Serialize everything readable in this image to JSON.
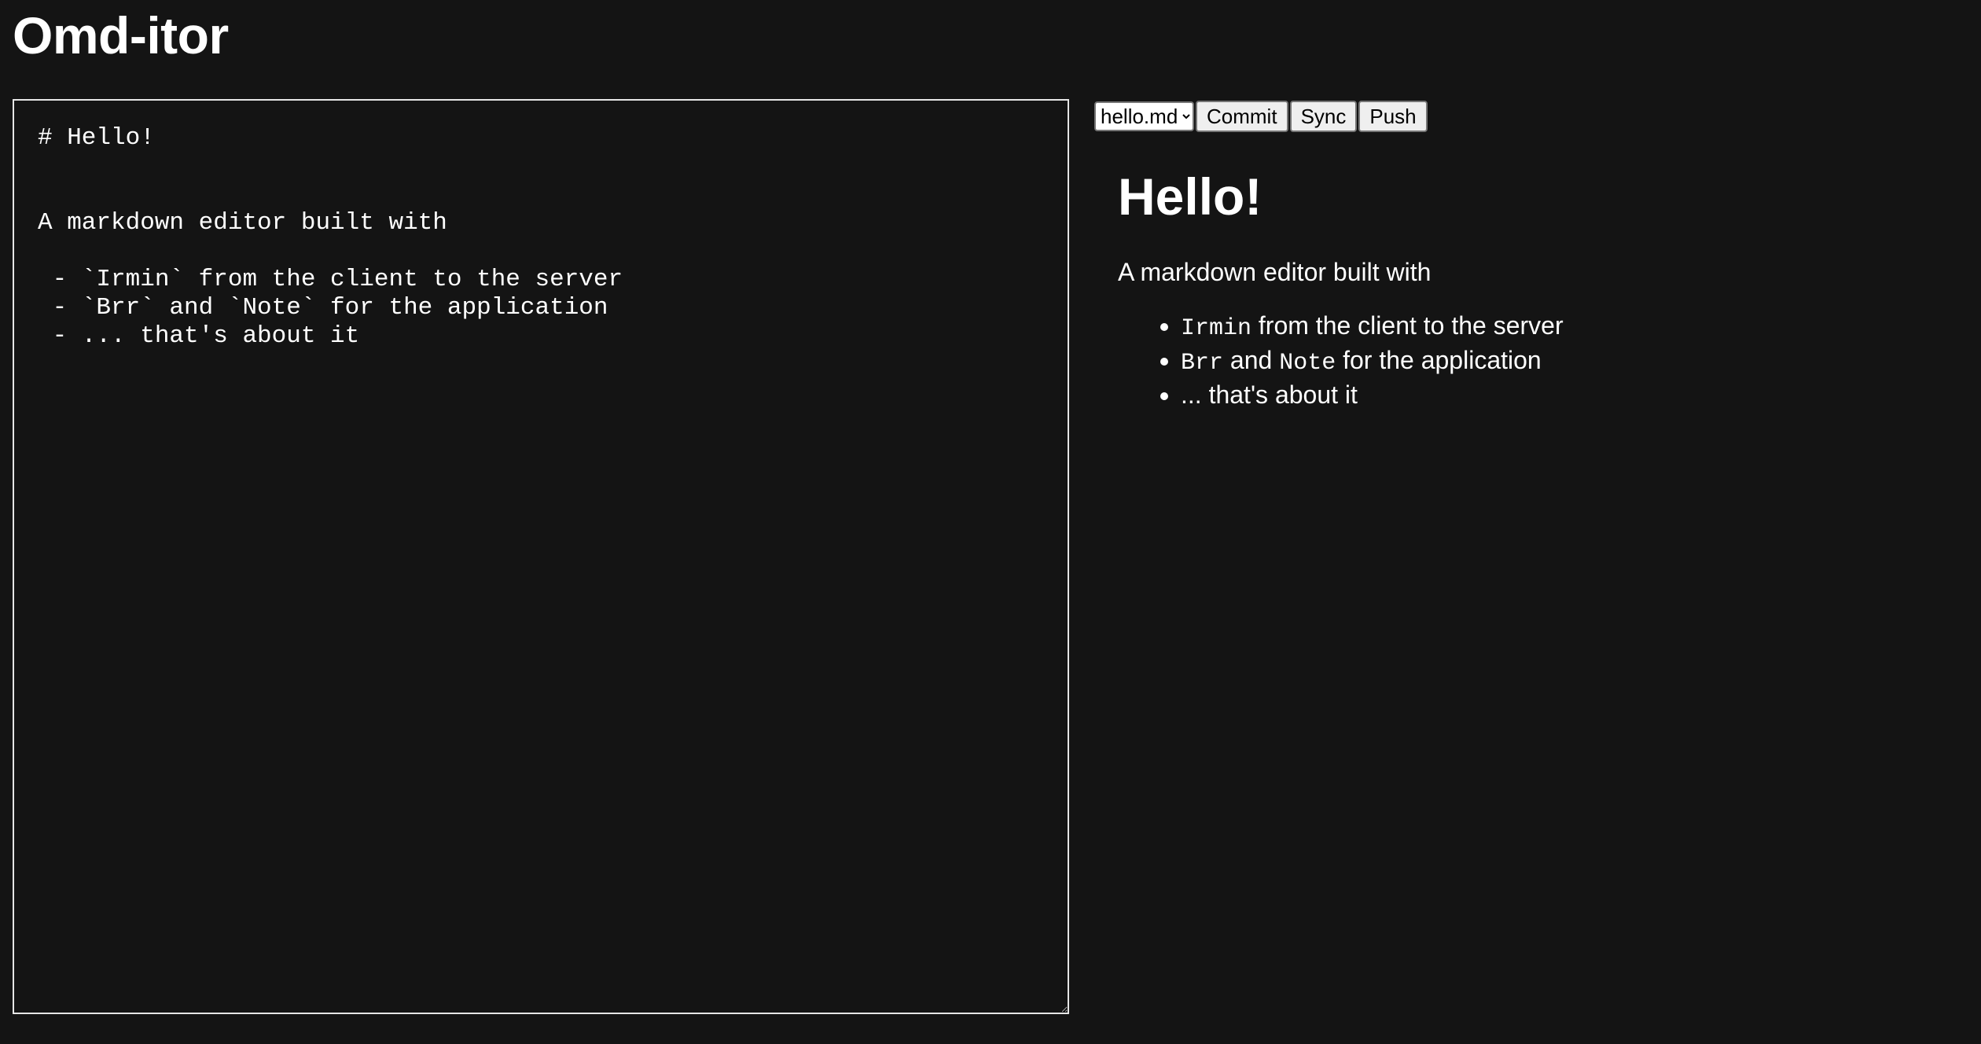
{
  "app": {
    "title": "Omd-itor"
  },
  "editor": {
    "content": "# Hello!\n\n\nA markdown editor built with\n\n - `Irmin` from the client to the server\n - `Brr` and `Note` for the application\n - ... that's about it"
  },
  "toolbar": {
    "file_select": {
      "selected": "hello.md",
      "options": [
        "hello.md"
      ]
    },
    "commit_label": "Commit",
    "sync_label": "Sync",
    "push_label": "Push"
  },
  "preview": {
    "heading": "Hello!",
    "paragraph": "A markdown editor built with",
    "items": [
      {
        "code1": "Irmin",
        "text1": " from the client to the server"
      },
      {
        "code1": "Brr",
        "text1": " and ",
        "code2": "Note",
        "text2": " for the application"
      },
      {
        "text1": "... that's about it"
      }
    ]
  },
  "colors": {
    "background": "#141414",
    "text": "#ffffff",
    "editor_border": "#e6e6e6",
    "button_bg": "#efefef"
  }
}
